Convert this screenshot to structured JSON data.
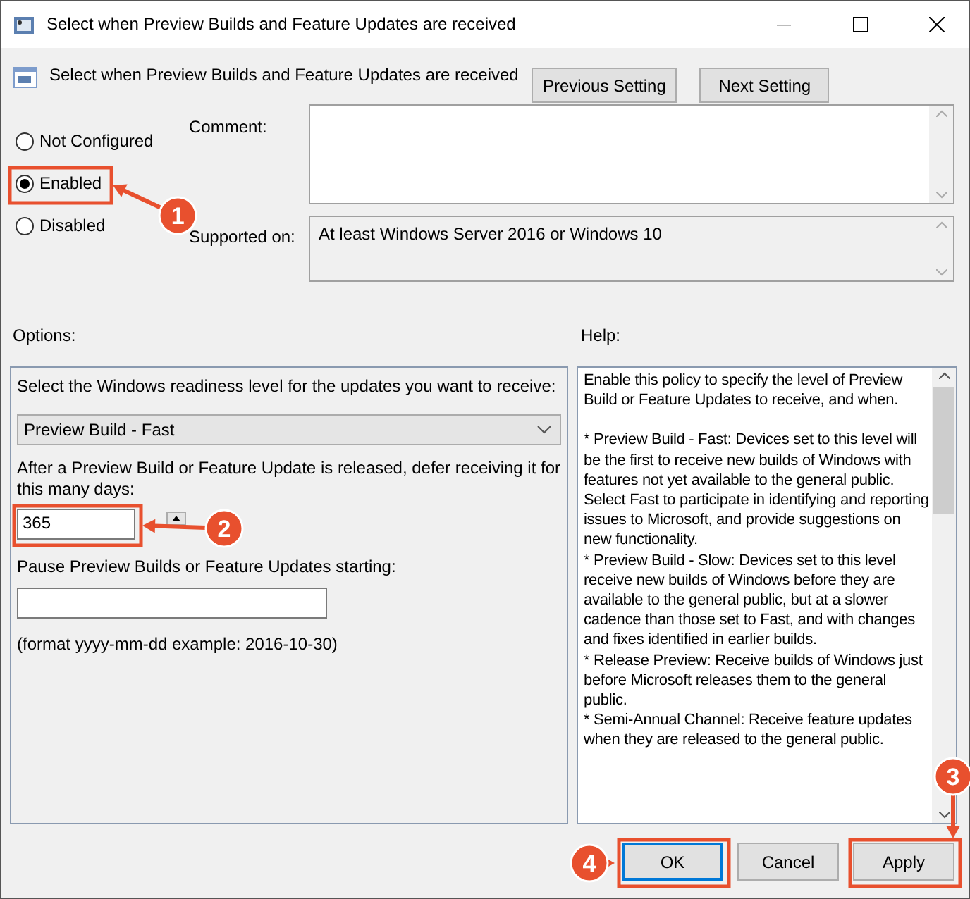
{
  "window": {
    "title": "Select when Preview Builds and Feature Updates are received"
  },
  "header": {
    "title": "Select when Preview Builds and Feature Updates are received",
    "buttons": [
      "Previous Setting",
      "Next Setting"
    ]
  },
  "state_options": [
    {
      "label": "Not Configured",
      "selected": false
    },
    {
      "label": "Enabled",
      "selected": true
    },
    {
      "label": "Disabled",
      "selected": false
    }
  ],
  "comment": {
    "label": "Comment:"
  },
  "supported_on": {
    "label": "Supported on:",
    "value": "At least Windows Server 2016 or Windows 10"
  },
  "options": {
    "label": "Options:",
    "readiness_prompt": "Select the Windows readiness level for the updates you want to receive:",
    "readiness_value": "Preview Build - Fast",
    "defer_prompt": "After a Preview Build or Feature Update is released, defer receiving it for this many days:",
    "defer_value": "365",
    "pause_prompt": "Pause Preview Builds or Feature Updates starting:",
    "pause_hint": "(format yyyy-mm-dd example: 2016-10-30)"
  },
  "help": {
    "label": "Help:",
    "paragraphs": [
      "Enable this policy to specify the level of Preview Build or Feature Updates to receive, and when.",
      "* Preview Build - Fast: Devices set to this level will be the first to receive new builds of Windows with features not yet available to the general public. Select Fast to participate in identifying and reporting issues to Microsoft, and provide suggestions on new functionality.",
      "* Preview Build - Slow: Devices set to this level receive new builds of Windows before they are available to the general public, but at a slower cadence than those set to Fast, and with changes and fixes identified in earlier builds.",
      "* Release Preview: Receive builds of Windows just before Microsoft releases them to the general public.",
      "* Semi-Annual Channel: Receive feature updates when they are released to the general public."
    ]
  },
  "footer_buttons": [
    {
      "label": "OK",
      "kind": "default"
    },
    {
      "label": "Cancel",
      "kind": "normal"
    },
    {
      "label": "Apply",
      "kind": "normal"
    }
  ],
  "annotations": [
    {
      "label": "1"
    },
    {
      "label": "2"
    },
    {
      "label": "3"
    },
    {
      "label": "4"
    }
  ]
}
